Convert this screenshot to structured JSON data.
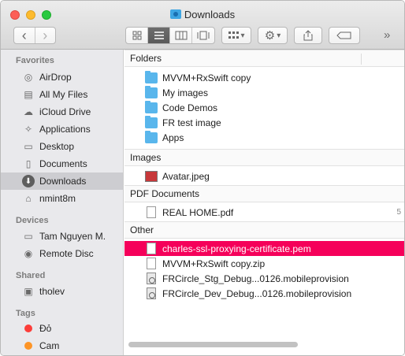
{
  "window": {
    "title": "Downloads"
  },
  "toolbar": {
    "back": "‹",
    "forward": "›",
    "overflow": "»",
    "view_icon": "☷",
    "gear_icon": "⚙",
    "caret": "▾",
    "share_icon": "⇪"
  },
  "sidebar": {
    "favorites_title": "Favorites",
    "favorites": [
      {
        "label": "AirDrop",
        "icon": "airdrop-icon",
        "glyph": "◎"
      },
      {
        "label": "All My Files",
        "icon": "all-files-icon",
        "glyph": "▤"
      },
      {
        "label": "iCloud Drive",
        "icon": "cloud-icon",
        "glyph": "☁"
      },
      {
        "label": "Applications",
        "icon": "applications-icon",
        "glyph": "✧"
      },
      {
        "label": "Desktop",
        "icon": "desktop-icon",
        "glyph": "▭"
      },
      {
        "label": "Documents",
        "icon": "documents-icon",
        "glyph": "▯"
      },
      {
        "label": "Downloads",
        "icon": "downloads-icon",
        "glyph": "⬇",
        "selected": true
      },
      {
        "label": "nmint8m",
        "icon": "home-icon",
        "glyph": "⌂"
      }
    ],
    "devices_title": "Devices",
    "devices": [
      {
        "label": "Tam Nguyen M.",
        "icon": "laptop-icon",
        "glyph": "▭"
      },
      {
        "label": "Remote Disc",
        "icon": "disc-icon",
        "glyph": "◉"
      }
    ],
    "shared_title": "Shared",
    "shared": [
      {
        "label": "tholev",
        "icon": "monitor-icon",
        "glyph": "▣"
      }
    ],
    "tags_title": "Tags",
    "tags": [
      {
        "label": "Đỏ",
        "color": "#fc3d39"
      },
      {
        "label": "Cam",
        "color": "#fd9426"
      }
    ]
  },
  "content": {
    "groups": [
      {
        "title": "Folders",
        "items": [
          {
            "name": "MVVM+RxSwift copy",
            "kind": "folder"
          },
          {
            "name": "My images",
            "kind": "folder"
          },
          {
            "name": "Code Demos",
            "kind": "folder"
          },
          {
            "name": "FR test image",
            "kind": "folder"
          },
          {
            "name": "Apps",
            "kind": "folder"
          }
        ]
      },
      {
        "title": "Images",
        "items": [
          {
            "name": "Avatar.jpeg",
            "kind": "image"
          }
        ]
      },
      {
        "title": "PDF Documents",
        "items": [
          {
            "name": "REAL HOME.pdf",
            "kind": "doc",
            "side": "5"
          }
        ]
      },
      {
        "title": "Other",
        "items": [
          {
            "name": "charles-ssl-proxying-certificate.pem",
            "kind": "doc",
            "selected": true
          },
          {
            "name": "MVVM+RxSwift copy.zip",
            "kind": "doc"
          },
          {
            "name": "FRCircle_Stg_Debug...0126.mobileprovision",
            "kind": "cert"
          },
          {
            "name": "FRCircle_Dev_Debug...0126.mobileprovision",
            "kind": "cert"
          }
        ]
      }
    ]
  },
  "colors": {
    "selection": "#f5005a",
    "folder": "#59b6ec",
    "sidebar_selection": "#cdcdd1"
  }
}
